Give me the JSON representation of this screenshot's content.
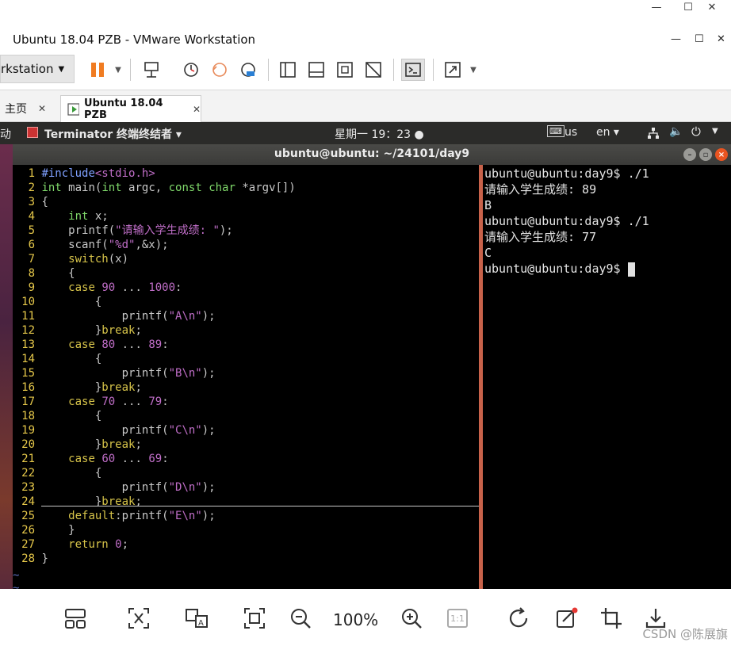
{
  "outer": {
    "minimize": "—",
    "maximize": "☐",
    "close": "✕"
  },
  "vmware": {
    "title": "Ubuntu 18.04 PZB - VMware Workstation",
    "workstation_menu": "rkstation",
    "tabs": [
      {
        "label": "主页"
      },
      {
        "label": "Ubuntu 18.04 PZB"
      }
    ],
    "tab_close": "✕"
  },
  "ubuntu_panel": {
    "left_partial": "动",
    "app_menu": "Terminator 终端终结者 ▾",
    "clock": "星期一 19：23",
    "keyboard": "us",
    "language": "en ▾"
  },
  "terminal": {
    "title": "ubuntu@ubuntu: ~/24101/day9",
    "code_lines": [
      {
        "n": "1",
        "parts": [
          [
            "pre",
            "#include"
          ],
          [
            "str",
            "<stdio.h>"
          ]
        ]
      },
      {
        "n": "2",
        "parts": [
          [
            "typ",
            "int"
          ],
          [
            "code",
            " main("
          ],
          [
            "typ",
            "int"
          ],
          [
            "code",
            " argc, "
          ],
          [
            "typ",
            "const char"
          ],
          [
            "code",
            " *argv[])"
          ]
        ]
      },
      {
        "n": "3",
        "parts": [
          [
            "code",
            "{"
          ]
        ]
      },
      {
        "n": "4",
        "parts": [
          [
            "code",
            "    "
          ],
          [
            "typ",
            "int"
          ],
          [
            "code",
            " x;"
          ]
        ]
      },
      {
        "n": "5",
        "parts": [
          [
            "code",
            "    printf("
          ],
          [
            "str",
            "\"请输入学生成绩: \""
          ],
          [
            "code",
            ");"
          ]
        ]
      },
      {
        "n": "6",
        "parts": [
          [
            "code",
            "    scanf("
          ],
          [
            "str",
            "\"%d\""
          ],
          [
            "code",
            ",&x);"
          ]
        ]
      },
      {
        "n": "7",
        "parts": [
          [
            "code",
            "    "
          ],
          [
            "kw",
            "switch"
          ],
          [
            "code",
            "(x)"
          ]
        ]
      },
      {
        "n": "8",
        "parts": [
          [
            "code",
            "    {"
          ]
        ]
      },
      {
        "n": "9",
        "parts": [
          [
            "code",
            "    "
          ],
          [
            "kw",
            "case"
          ],
          [
            "code",
            " "
          ],
          [
            "num",
            "90"
          ],
          [
            "code",
            " ... "
          ],
          [
            "num",
            "1000"
          ],
          [
            "code",
            ":"
          ]
        ]
      },
      {
        "n": "10",
        "parts": [
          [
            "code",
            "        {"
          ]
        ]
      },
      {
        "n": "11",
        "parts": [
          [
            "code",
            "            printf("
          ],
          [
            "str",
            "\"A\\n\""
          ],
          [
            "code",
            ");"
          ]
        ]
      },
      {
        "n": "12",
        "parts": [
          [
            "code",
            "        }"
          ],
          [
            "kw",
            "break"
          ],
          [
            "code",
            ";"
          ]
        ]
      },
      {
        "n": "13",
        "parts": [
          [
            "code",
            "    "
          ],
          [
            "kw",
            "case"
          ],
          [
            "code",
            " "
          ],
          [
            "num",
            "80"
          ],
          [
            "code",
            " ... "
          ],
          [
            "num",
            "89"
          ],
          [
            "code",
            ":"
          ]
        ]
      },
      {
        "n": "14",
        "parts": [
          [
            "code",
            "        {"
          ]
        ]
      },
      {
        "n": "15",
        "parts": [
          [
            "code",
            "            printf("
          ],
          [
            "str",
            "\"B\\n\""
          ],
          [
            "code",
            ");"
          ]
        ]
      },
      {
        "n": "16",
        "parts": [
          [
            "code",
            "        }"
          ],
          [
            "kw",
            "break"
          ],
          [
            "code",
            ";"
          ]
        ]
      },
      {
        "n": "17",
        "parts": [
          [
            "code",
            "    "
          ],
          [
            "kw",
            "case"
          ],
          [
            "code",
            " "
          ],
          [
            "num",
            "70"
          ],
          [
            "code",
            " ... "
          ],
          [
            "num",
            "79"
          ],
          [
            "code",
            ":"
          ]
        ]
      },
      {
        "n": "18",
        "parts": [
          [
            "code",
            "        {"
          ]
        ]
      },
      {
        "n": "19",
        "parts": [
          [
            "code",
            "            printf("
          ],
          [
            "str",
            "\"C\\n\""
          ],
          [
            "code",
            ");"
          ]
        ]
      },
      {
        "n": "20",
        "parts": [
          [
            "code",
            "        }"
          ],
          [
            "kw",
            "break"
          ],
          [
            "code",
            ";"
          ]
        ]
      },
      {
        "n": "21",
        "parts": [
          [
            "code",
            "    "
          ],
          [
            "kw",
            "case"
          ],
          [
            "code",
            " "
          ],
          [
            "num",
            "60"
          ],
          [
            "code",
            " ... "
          ],
          [
            "num",
            "69"
          ],
          [
            "code",
            ":"
          ]
        ]
      },
      {
        "n": "22",
        "parts": [
          [
            "code",
            "        {"
          ]
        ]
      },
      {
        "n": "23",
        "parts": [
          [
            "code",
            "            printf("
          ],
          [
            "str",
            "\"D\\n\""
          ],
          [
            "code",
            ");"
          ]
        ]
      },
      {
        "n": "24",
        "parts": [
          [
            "code",
            "        }"
          ],
          [
            "kw",
            "break"
          ],
          [
            "code",
            ";"
          ]
        ]
      },
      {
        "n": "25",
        "parts": [
          [
            "code",
            "    "
          ],
          [
            "kw",
            "default"
          ],
          [
            "code",
            ":printf("
          ],
          [
            "str",
            "\"E\\n\""
          ],
          [
            "code",
            ");"
          ]
        ]
      },
      {
        "n": "26",
        "parts": [
          [
            "code",
            "    }"
          ]
        ]
      },
      {
        "n": "27",
        "parts": [
          [
            "code",
            "    "
          ],
          [
            "kw",
            "return"
          ],
          [
            "code",
            " "
          ],
          [
            "num",
            "0"
          ],
          [
            "code",
            ";"
          ]
        ]
      },
      {
        "n": "28",
        "parts": [
          [
            "code",
            "}"
          ]
        ]
      }
    ],
    "tilde": "~",
    "output_lines": [
      "ubuntu@ubuntu:day9$ ./1",
      "请输入学生成绩: 89",
      "B",
      "ubuntu@ubuntu:day9$ ./1",
      "请输入学生成绩: 77",
      "C",
      "ubuntu@ubuntu:day9$ "
    ]
  },
  "viewer": {
    "zoom": "100%",
    "watermark": "CSDN @陈展旗",
    "one_to_one": "1:1"
  },
  "colors": {
    "panel": "#2b2b29",
    "divider": "#c8624a",
    "pause": "#f07c22"
  }
}
